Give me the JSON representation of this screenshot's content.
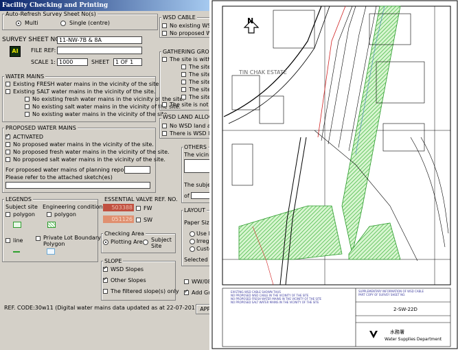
{
  "window": {
    "title": "Facility Checking and Printing"
  },
  "auto_refresh": {
    "label": "Auto-Refresh Survey Sheet No(s)",
    "multi": "Multi",
    "single": "Single (centre)"
  },
  "survey": {
    "sheet_no_label": "SURVEY SHEET NO.:",
    "sheet_no_value": "11-NW-7B & 8A",
    "logo": "AI",
    "file_ref_label": "FILE REF:",
    "scale_label": "SCALE 1:",
    "scale_value": "1000",
    "sheet_label": "SHEET",
    "sheet_value": "1 OF 1"
  },
  "water_mains": {
    "title": "WATER MAINS",
    "items": [
      "Existing FRESH water mains in the vicinity of the site.",
      "Existing SALT water mains in the vicinity of the site.",
      "No existing fresh water mains in the vicinity of the site.",
      "No existing salt water mains in the vicinity of the site.",
      "No existing water mains in the vicinity of the site."
    ]
  },
  "proposed": {
    "title": "PROPOSED WATER MAINS",
    "activated": "ACTIVATED",
    "items": [
      "No proposed water mains in the vicinity of the site.",
      "No proposed fresh water mains in the vicinity of the site.",
      "No proposed salt water mains in the vicinity of the site."
    ],
    "planning_label": "For proposed water mains of planning report no(s).",
    "sketch_label": "Please refer to the attached sketch(es)"
  },
  "legends": {
    "title": "LEGENDS",
    "subject_site": "Subject site",
    "engineering": "Engineering condition",
    "polygon": "polygon",
    "line": "line",
    "private_lot": "Private Lot Boundary",
    "private_lot_2": "Polygon"
  },
  "valve": {
    "title": "ESSENTIAL VALVE REF. NO.",
    "v1": "503388",
    "v2": "051126",
    "fw": "FW",
    "sw": "SW"
  },
  "checking_area": {
    "title": "Checking Area",
    "plotting": "Plotting Area",
    "subject": "Subject",
    "subject_2": "Site"
  },
  "slope": {
    "title": "SLOPE",
    "items": [
      "WSD Slopes",
      "Other Slopes",
      "The filtered slope(s) only"
    ]
  },
  "ref_code": "REF. CODE:30w11 (Digital water mains data updated as at 22-07-2011)",
  "wsd_cable": {
    "title": "WSD CABLE",
    "items": [
      "No existing WSD",
      "No proposed WSI"
    ]
  },
  "gathering": {
    "title": "GATHERING GROU",
    "item1": "The site is within '",
    "sub": [
      "The site i",
      "The site i",
      "The site i",
      "The site i",
      "The site i"
    ],
    "item_last": "The site is not wit"
  },
  "land_alloc": {
    "title": "WSD LAND ALLOCA",
    "items": [
      "No WSD land allc",
      "There is WSD lan"
    ]
  },
  "others": {
    "title": "OTHERS",
    "vicinity": "The vicinity",
    "subject": "The subjec",
    "of": "of"
  },
  "layout": {
    "title": "LAYOUT",
    "paper_size": "Paper Size",
    "items": [
      "Use L",
      "Irregu",
      "Custo"
    ],
    "selected": "Selected L"
  },
  "bottom": {
    "wwo": "WW/08",
    "add_grid": "Add Grid",
    "apply": "APPL"
  },
  "map": {
    "north": "N",
    "estate": "TIN CHAK ESTATE",
    "notes": [
      "EXISTING WSD CABLE SHOWN THUS",
      "NO PROPOSED WSD CABLE IN THE VICINITY OF THE SITE",
      "NO PROPOSED FRESH WATER MAINS IN THE VICINITY OF THE SITE",
      "NO PROPOSED SALT WATER MAINS IN THE VICINITY OF THE SITE"
    ],
    "supp": [
      "SUPPLEMENTARY INFORMATION OF WSD CABLE",
      "PART COPY OF SURVEY SHEET NO."
    ],
    "sheet_code": "2-SW-22D",
    "dept": "Water Supplies Department",
    "dept_chinese": "水務署"
  }
}
